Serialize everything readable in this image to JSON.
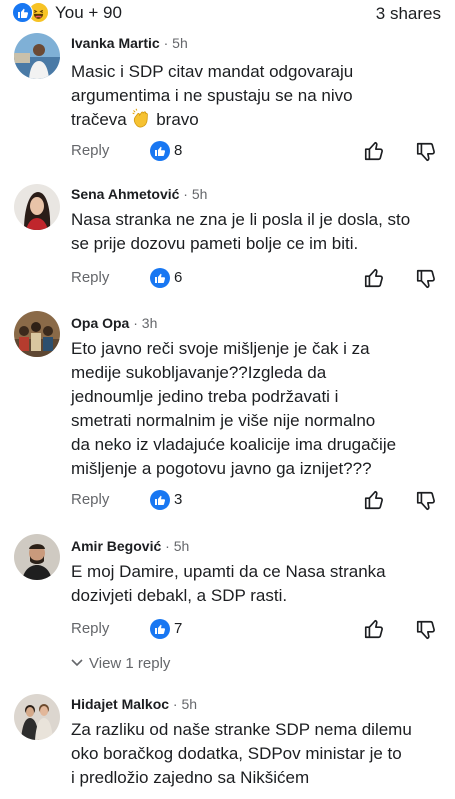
{
  "header": {
    "reaction_summary": "You + 90",
    "shares": "3 shares",
    "reaction_icons": [
      "like-icon",
      "haha-icon"
    ]
  },
  "labels": {
    "reply": "Reply"
  },
  "colors": {
    "facebook_blue": "#1877f2",
    "secondary_text": "#65676b",
    "primary_text": "#1c1e21"
  },
  "comments": [
    {
      "name": "Ivanka Martic",
      "time": " · 5h",
      "lines": [
        "Masic i SDP citav mandat odgovaraju",
        "argumentima i ne spustaju se na nivo",
        "tračeva",
        "bravo"
      ],
      "emoji": "clapping-hands-icon",
      "likes": "8"
    },
    {
      "name": "Sena Ahmetović",
      "time": " · 5h",
      "lines": [
        "Nasa stranka ne zna je li posla il je dosla, sto",
        "se prije dozovu pameti bolje ce im biti."
      ],
      "likes": "6"
    },
    {
      "name": "Opa Opa",
      "time": " · 3h",
      "lines": [
        "Eto javno reči svoje mišljenje je čak i za",
        "medije sukobljavanje??Izgleda da",
        "jednoumlje jedino treba podržavati i",
        "smetrati normalnim je više nije normalno",
        "da neko iz vladajuće koalicije ima drugačije",
        "mišljenje a pogotovu javno ga iznijet???"
      ],
      "likes": "3"
    },
    {
      "name": "Amir Begović",
      "time": " · 5h",
      "lines": [
        "E moj Damire, upamti da ce Nasa stranka",
        "dozivjeti debakl, a SDP rasti."
      ],
      "likes": "7",
      "view_replies": "View 1 reply"
    },
    {
      "name": "Hidajet Malkoc",
      "time": " · 5h",
      "lines": [
        "Za razliku od naše stranke SDP nema dilemu",
        "oko boračkog dodatka, SDPov ministar je to",
        "i predložio zajedno sa Nikšićem"
      ]
    }
  ]
}
